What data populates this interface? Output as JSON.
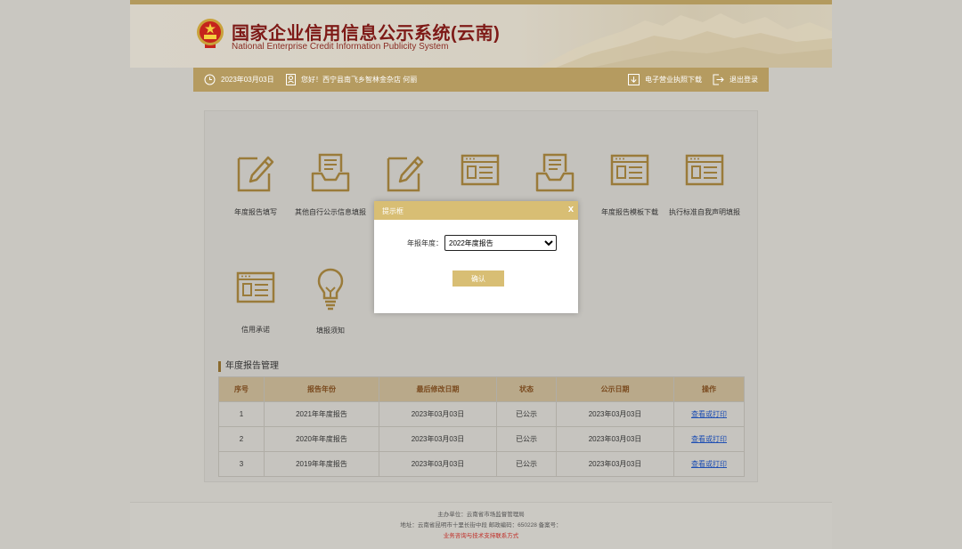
{
  "header": {
    "title": "国家企业信用信息公示系统(云南)",
    "subtitle": "National Enterprise Credit Information Publicity System"
  },
  "infobar": {
    "date": "2023年03月03日",
    "greeting": "您好！西宁县南飞乡智林金杂店  何丽",
    "download_license": "电子营业执照下载",
    "logout": "退出登录"
  },
  "tiles": [
    {
      "label": "年度报告填写",
      "icon": "pencil-form-icon"
    },
    {
      "label": "其他自行公示信息填报",
      "icon": "document-tray-icon"
    },
    {
      "label": "",
      "icon": "pencil-form-icon"
    },
    {
      "label": "",
      "icon": "web-form-icon"
    },
    {
      "label": "",
      "icon": "document-tray-icon"
    },
    {
      "label": "年度报告模板下载",
      "icon": "web-form-icon"
    },
    {
      "label": "执行标准自我声明填报",
      "icon": "web-form-icon"
    },
    {
      "label": "信用承诺",
      "icon": "web-form-icon"
    },
    {
      "label": "填报须知",
      "icon": "lightbulb-icon"
    }
  ],
  "report_section": {
    "title": "年度报告管理",
    "columns": [
      "序号",
      "报告年份",
      "最后修改日期",
      "状态",
      "公示日期",
      "操作"
    ],
    "rows": [
      {
        "no": "1",
        "year": "2021年年度报告",
        "modified": "2023年03月03日",
        "status": "已公示",
        "publish": "2023年03月03日",
        "action": "查看或打印"
      },
      {
        "no": "2",
        "year": "2020年年度报告",
        "modified": "2023年03月03日",
        "status": "已公示",
        "publish": "2023年03月03日",
        "action": "查看或打印"
      },
      {
        "no": "3",
        "year": "2019年年度报告",
        "modified": "2023年03月03日",
        "status": "已公示",
        "publish": "2023年03月03日",
        "action": "查看或打印"
      }
    ]
  },
  "footer": {
    "line1": "主办单位：云南省市场监督管理局",
    "line2": "地址：云南省昆明市十里长街中段  邮政编码：650228  备案号：",
    "line3": "业务咨询与技术支持联系方式"
  },
  "modal": {
    "title": "提示框",
    "close": "x",
    "field_label": "年报年度：",
    "selected_year": "2022年度报告",
    "confirm": "确认"
  },
  "colors": {
    "gold": "#b59b60",
    "modal_gold": "#d8be74",
    "title_red": "#7e1a17",
    "icon_gold": "#9a7b3a",
    "link_blue": "#1f4fb3"
  }
}
